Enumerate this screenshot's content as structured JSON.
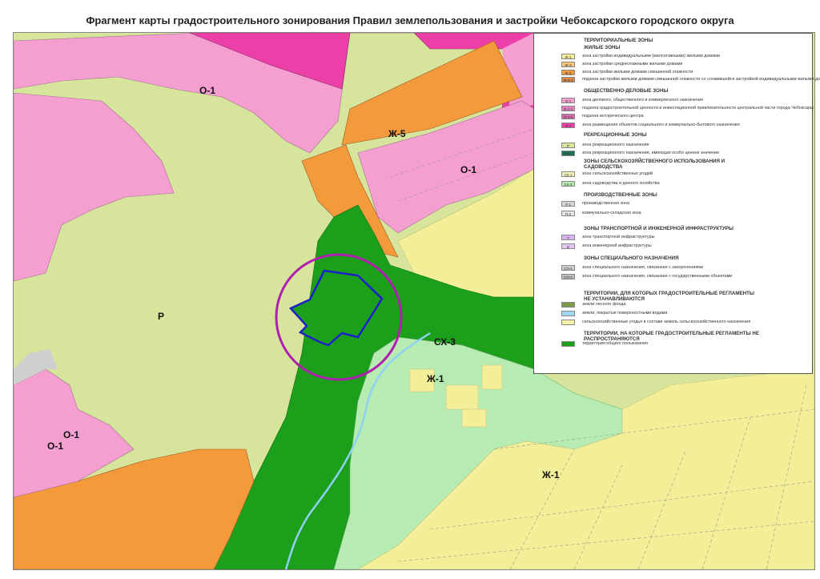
{
  "title": "Фрагмент карты градостроительного зонирования Правил землепользования и застройки Чебоксарского городского округа",
  "map_labels": [
    {
      "text": "О-1"
    },
    {
      "text": "Ж-5"
    },
    {
      "text": "О-1"
    },
    {
      "text": "Р"
    },
    {
      "text": "СХ-3"
    },
    {
      "text": "Ж-1"
    },
    {
      "text": "О-1"
    },
    {
      "text": "О-1"
    },
    {
      "text": "Ж-1"
    }
  ],
  "colors": {
    "recreation": "#d6e59b",
    "residential_ind": "#f3ef98",
    "residential_mid": "#f59a3c",
    "public_o1": "#f59fd0",
    "magenta_zone": "#ec3fa7",
    "common_green": "#1ca01c",
    "garden_green": "#b6ecb1",
    "water": "#8fd0f5",
    "circle_marker": "#b01fb0",
    "parcel_outline": "#1f1fc9"
  },
  "legend": {
    "title": "ТЕРРИТОРИАЛЬНЫЕ ЗОНЫ",
    "sections": [
      {
        "heading": "ЖИЛЫЕ ЗОНЫ",
        "items": [
          {
            "code": "Ж-1",
            "text": "зона застройки индивидуальными (малоэтажными) жилыми домами",
            "color": "#f3ef98"
          },
          {
            "code": "Ж-3",
            "text": "зона застройки среднеэтажными жилыми домами",
            "color": "#f7c57a"
          },
          {
            "code": "Ж-5",
            "text": "зона застройки жилыми домами смешанной этажности",
            "color": "#f59a3c"
          },
          {
            "code": "Ж-5.1",
            "text": "подзона застройки жилыми домами смешанной этажности со сложившейся застройкой индивидуальными жилыми домами",
            "color": "#d98a45"
          }
        ]
      },
      {
        "heading": "ОБЩЕСТВЕННО-ДЕЛОВЫЕ ЗОНЫ",
        "items": [
          {
            "code": "О-1",
            "text": "зона делового, общественного и коммерческого назначения",
            "color": "#f59fd0"
          },
          {
            "code": "О-1.1",
            "text": "подзона градостроительной ценности и инвестиционной привлекательности центральной части города Чебоксары",
            "color": "#e47fbd"
          },
          {
            "code": "О-1.2",
            "text": "подзона исторического центра",
            "color": "#d66aa9"
          },
          {
            "code": "О-2",
            "text": "зона размещения объектов социального и коммунально-бытового назначения",
            "color": "#ec3fa7"
          }
        ]
      },
      {
        "heading": "РЕКРЕАЦИОННЫЕ ЗОНЫ",
        "items": [
          {
            "code": "Р",
            "text": "зона рекреационного назначения",
            "color": "#d6e59b"
          },
          {
            "code": "Р-1",
            "text": "зона рекреационного назначения, имеющая особо ценное значение",
            "color": "#1f6f5a"
          }
        ]
      },
      {
        "heading": "ЗОНЫ СЕЛЬСКОХОЗЯЙСТВЕННОГО ИСПОЛЬЗОВАНИЯ И САДОВОДСТВА",
        "items": [
          {
            "code": "СХ-1",
            "text": "зона сельскохозяйственных угодий",
            "color": "#f6f4b8"
          },
          {
            "code": "СХ-3",
            "text": "зона садоводства и дачного хозяйства",
            "color": "#b6ecb1"
          }
        ]
      },
      {
        "heading": "ПРОИЗВОДСТВЕННЫЕ ЗОНЫ",
        "items": [
          {
            "code": "П-1",
            "text": "производственная зона",
            "color": "#d7d7d7"
          },
          {
            "code": "П-2",
            "text": "коммунально-складская зона",
            "color": "#e6e6e6"
          }
        ]
      },
      {
        "heading": "ЗОНЫ ТРАНСПОРТНОЙ И ИНЖЕНЕРНОЙ ИНФРАСТРУКТУРЫ",
        "items": [
          {
            "code": "Т",
            "text": "зона транспортной инфраструктуры",
            "color": "#d9b3f0"
          },
          {
            "code": "И",
            "text": "зона инженерной инфраструктуры",
            "color": "#e4c8f3"
          }
        ]
      },
      {
        "heading": "ЗОНЫ СПЕЦИАЛЬНОГО НАЗНАЧЕНИЯ",
        "items": [
          {
            "code": "СП-1",
            "text": "зона специального назначения, связанная с захоронениями",
            "color": "#cfcfcf"
          },
          {
            "code": "СП-2",
            "text": "зона специального назначения, связанная с государственными объектами",
            "color": "#bdbdbd"
          }
        ]
      },
      {
        "heading": "ТЕРРИТОРИИ, ДЛЯ КОТОРЫХ ГРАДОСТРОИТЕЛЬНЫЕ РЕГЛАМЕНТЫ НЕ УСТАНАВЛИВАЮТСЯ",
        "items": [
          {
            "code": "",
            "text": "земли лесного фонда",
            "color": "#7a9a4a"
          },
          {
            "code": "",
            "text": "земли, покрытые поверхностными водами",
            "color": "#9fd6f2"
          },
          {
            "code": "",
            "text": "сельскохозяйственные угодья в составе земель сельскохозяйственного назначения",
            "color": "#f6f2a8"
          }
        ]
      },
      {
        "heading": "ТЕРРИТОРИИ, НА КОТОРЫЕ ГРАДОСТРОИТЕЛЬНЫЕ РЕГЛАМЕНТЫ НЕ РАСПРОСТРАНЯЮТСЯ",
        "items": [
          {
            "code": "",
            "text": "территория общего пользования",
            "color": "#1ca01c"
          }
        ]
      }
    ]
  }
}
